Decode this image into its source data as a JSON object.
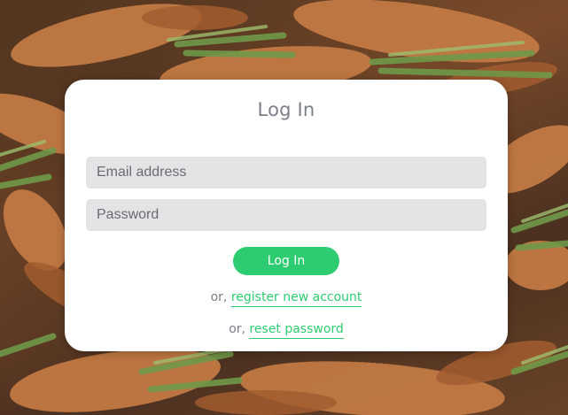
{
  "page": {
    "title": "Log In"
  },
  "form": {
    "email_placeholder": "Email address",
    "email_value": "",
    "password_placeholder": "Password",
    "password_value": "",
    "submit_label": "Log In"
  },
  "links": {
    "register_prefix": "or, ",
    "register_label": "register new account",
    "reset_prefix": "or, ",
    "reset_label": "reset password"
  },
  "colors": {
    "accent": "#2ecc71",
    "card": "#ffffff",
    "field_bg": "#e4e4e6",
    "muted_text": "#7b7f88"
  },
  "background": {
    "image": "carrots-photo"
  }
}
